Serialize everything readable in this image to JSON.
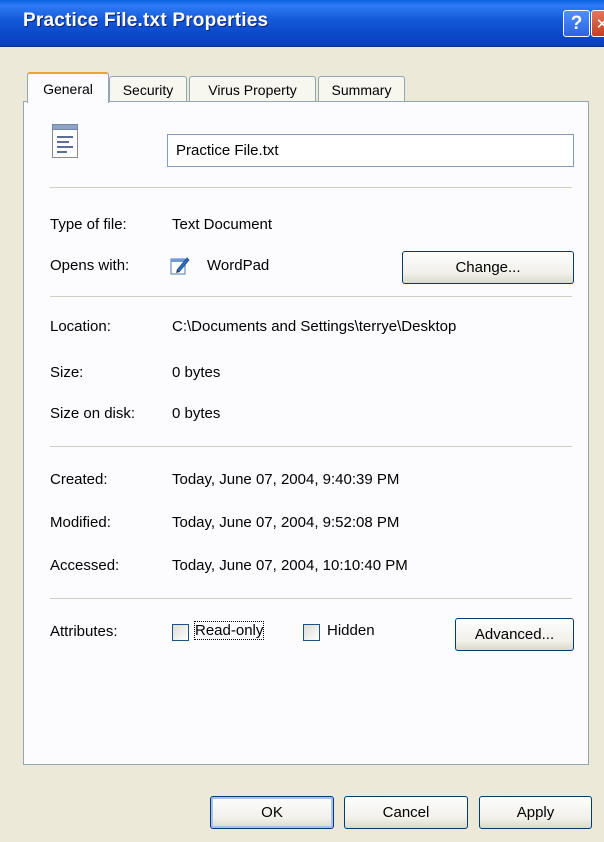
{
  "window": {
    "title": "Practice File.txt Properties",
    "help_glyph": "?",
    "close_glyph": "✕"
  },
  "tabs": [
    {
      "label": "General",
      "active": true
    },
    {
      "label": "Security"
    },
    {
      "label": "Virus Property"
    },
    {
      "label": "Summary"
    }
  ],
  "general": {
    "file_name": "Practice File.txt",
    "type_label": "Type of file:",
    "type_value": "Text Document",
    "opens_label": "Opens with:",
    "opens_value": "WordPad",
    "change_button": "Change...",
    "location_label": "Location:",
    "location_value": "C:\\Documents and Settings\\terrye\\Desktop",
    "size_label": "Size:",
    "size_value": "0 bytes",
    "size_on_disk_label": "Size on disk:",
    "size_on_disk_value": "0 bytes",
    "created_label": "Created:",
    "created_value": "Today, June 07, 2004, 9:40:39 PM",
    "modified_label": "Modified:",
    "modified_value": "Today, June 07, 2004, 9:52:08 PM",
    "accessed_label": "Accessed:",
    "accessed_value": "Today, June 07, 2004, 10:10:40 PM",
    "attributes_label": "Attributes:",
    "readonly_label": "Read-only",
    "hidden_label": "Hidden",
    "advanced_button": "Advanced..."
  },
  "footer": {
    "ok_button": "OK",
    "cancel_button": "Cancel",
    "apply_button": "Apply"
  },
  "colors": {
    "titlebar": "#0b46c8",
    "tab_highlight": "#e7a23a",
    "dialog_bg": "#ece9d8"
  }
}
